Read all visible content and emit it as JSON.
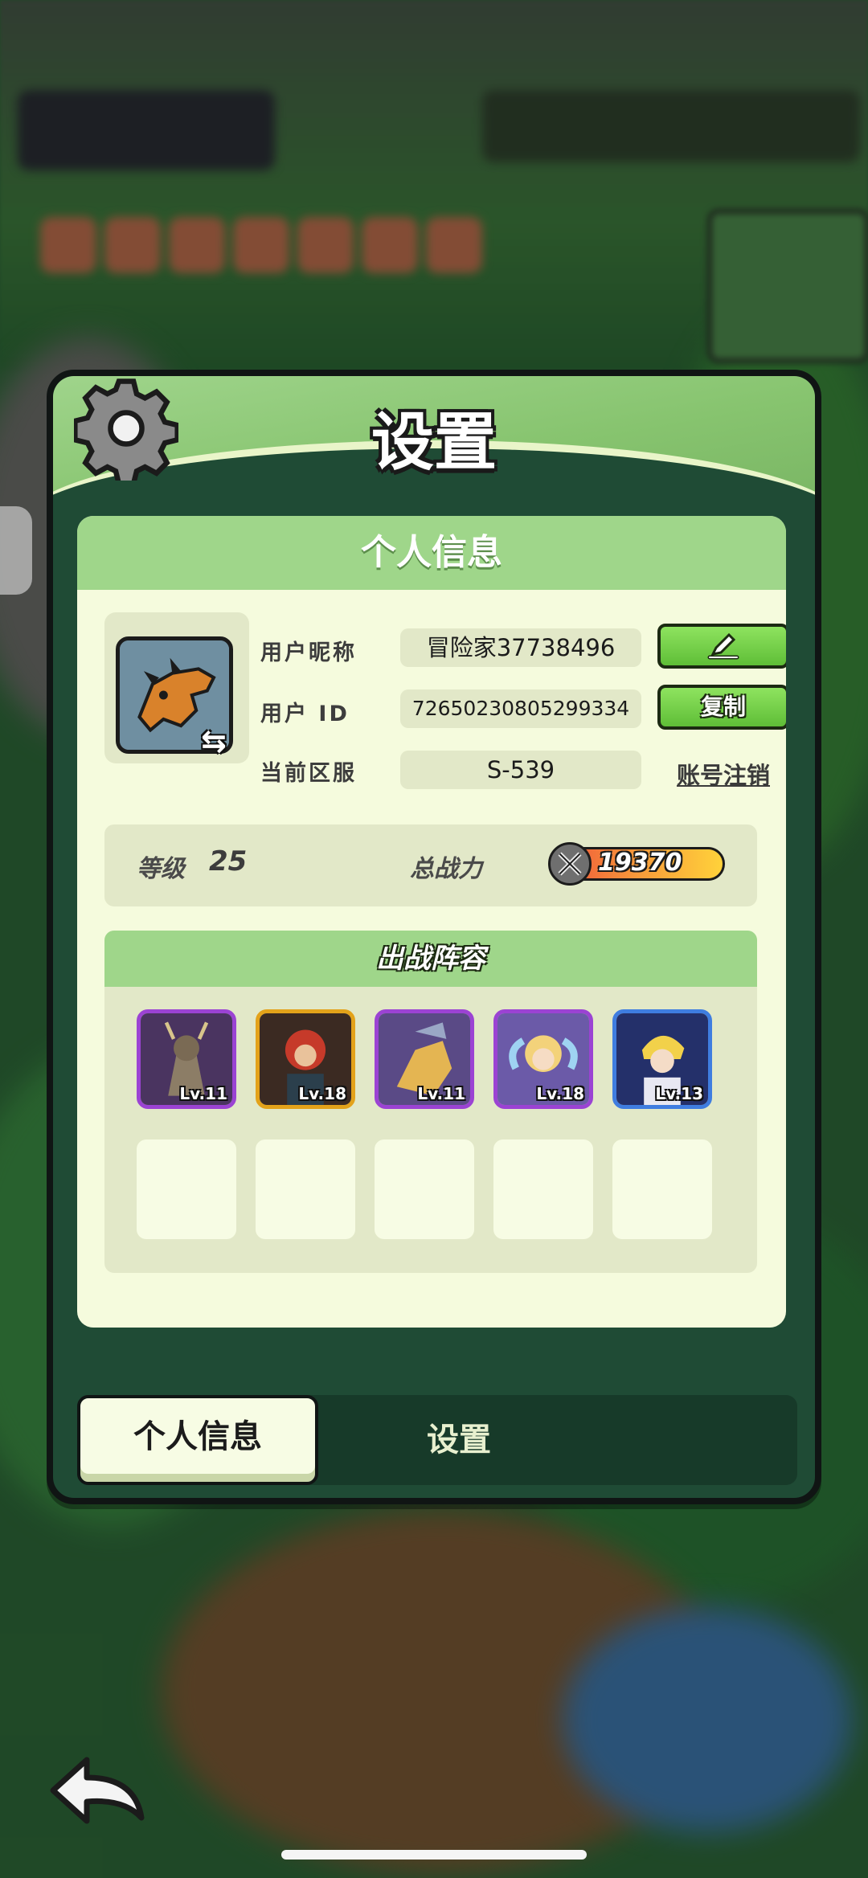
{
  "panel": {
    "title": "设置"
  },
  "section_title": "个人信息",
  "profile": {
    "nickname_label": "用户昵称",
    "nickname_value": "冒险家37738496",
    "id_label": "用户 ID",
    "id_value": "7265023080529933​4",
    "server_label": "当前区服",
    "server_value": "S-539",
    "edit_icon": "pencil-icon",
    "copy_label": "复制",
    "delete_account_label": "账号注销"
  },
  "stats": {
    "level_label": "等级",
    "level_value": "25",
    "power_label": "总战力",
    "power_value": "19370"
  },
  "lineup": {
    "title": "出战阵容",
    "heroes": [
      {
        "level": "Lv.11",
        "frame": "purple"
      },
      {
        "level": "Lv.18",
        "frame": "orange"
      },
      {
        "level": "Lv.11",
        "frame": "purple"
      },
      {
        "level": "Lv.18",
        "frame": "purple"
      },
      {
        "level": "Lv.13",
        "frame": "blue"
      }
    ]
  },
  "tabs": {
    "active": "个人信息",
    "other": "设置"
  },
  "colors": {
    "accent_green": "#9fd68a",
    "panel_dark": "#1f4b35",
    "card_bg": "#f5fbdd"
  }
}
